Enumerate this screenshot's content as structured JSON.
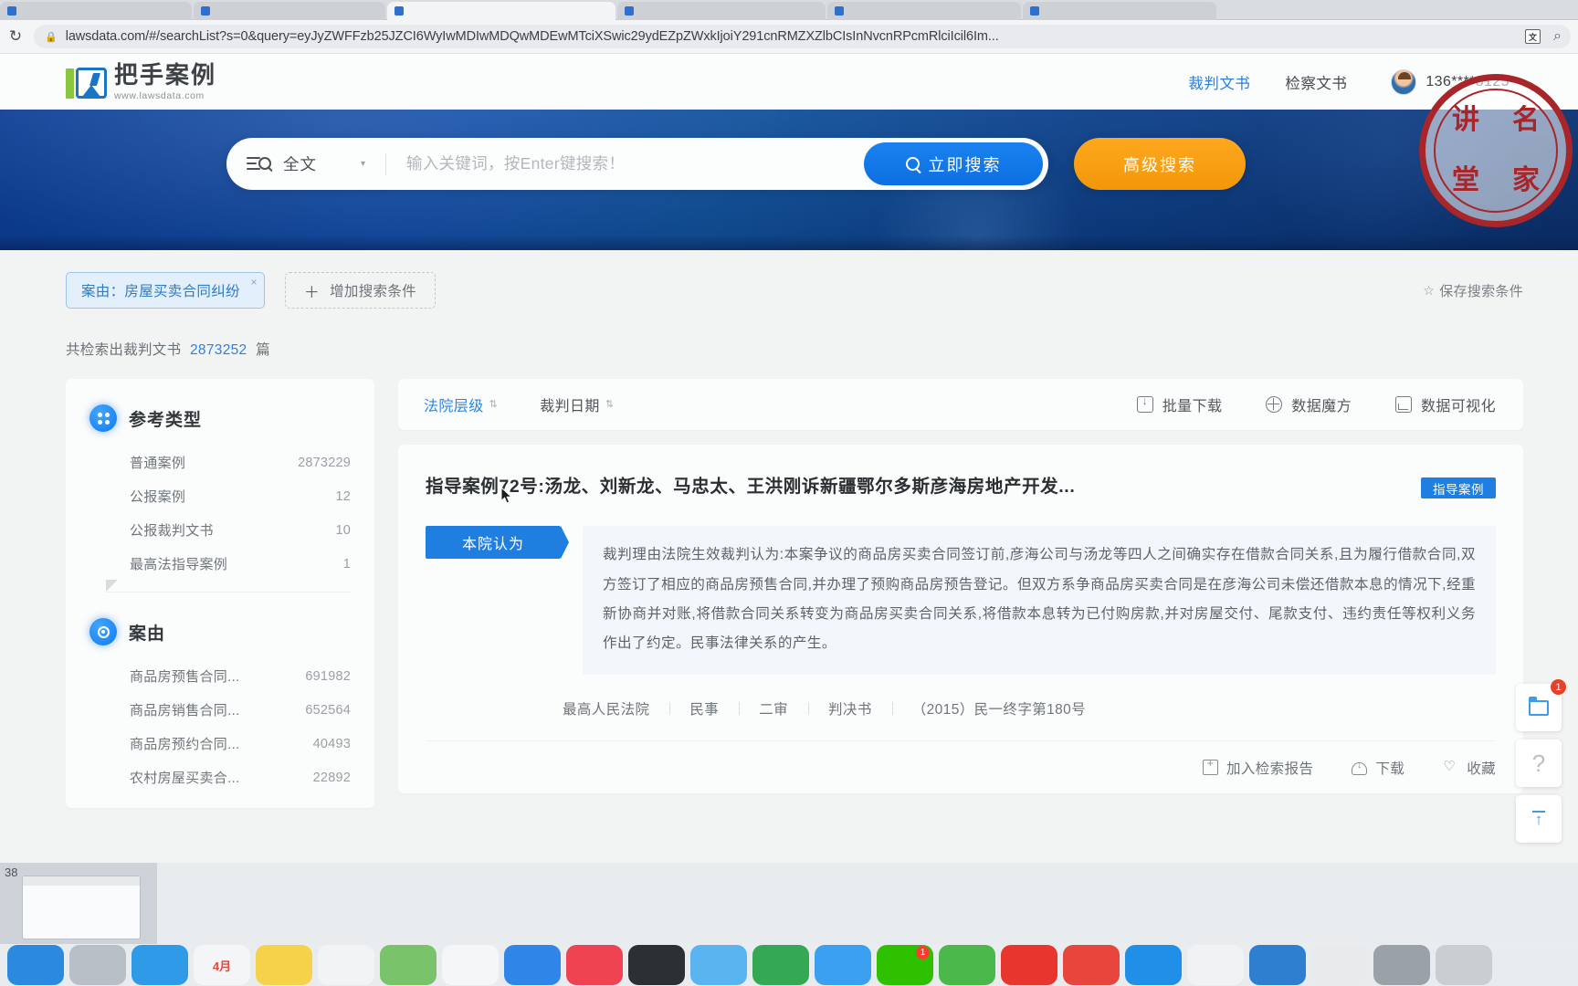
{
  "browser": {
    "url": "lawsdata.com/#/searchList?s=0&query=eyJyZWFFzb25JZCI6WyIwMDIwMDQwMDEwMTciXSwic29ydEZpZWxkIjoiY291cnRMZXZlbCIsInNvcnRPcmRlciIcil6Im...",
    "reload_icon": "↻",
    "lock_icon": "🔒",
    "translate_icon": "文",
    "search_icon": "⌕",
    "tabs": [
      {
        "title": ""
      },
      {
        "title": ""
      },
      {
        "title": ""
      },
      {
        "title": ""
      },
      {
        "title": ""
      },
      {
        "title": ""
      }
    ]
  },
  "site": {
    "brand_name": "把手案例",
    "brand_domain": "www.lawsdata.com",
    "nav": [
      {
        "label": "裁判文书",
        "active": true
      },
      {
        "label": "检察文书",
        "active": false
      }
    ],
    "account": {
      "id": "136****8125",
      "caret": "▾"
    }
  },
  "search": {
    "scope_label": "全文",
    "scope_caret": "▾",
    "placeholder": "输入关键词，按Enter键搜索！",
    "value": "",
    "search_button": "立即搜索",
    "advanced_button": "高级搜索"
  },
  "filters": {
    "chip": {
      "label": "案由：房屋买卖合同纠纷",
      "close": "×"
    },
    "add_condition": "增加搜索条件",
    "add_plus": "＋",
    "save_condition": "保存搜索条件",
    "save_star": "☆"
  },
  "results_summary": {
    "prefix": "共检索出裁判文书",
    "count": "2873252",
    "suffix": "篇"
  },
  "sidebar": {
    "facets": [
      {
        "title": "参考类型",
        "icon": "grid-dots-icon",
        "items": [
          {
            "label": "普通案例",
            "count": "2873229"
          },
          {
            "label": "公报案例",
            "count": "12"
          },
          {
            "label": "公报裁判文书",
            "count": "10"
          },
          {
            "label": "最高法指导案例",
            "count": "1"
          }
        ]
      },
      {
        "title": "案由",
        "icon": "target-icon",
        "items": [
          {
            "label": "商品房预售合同...",
            "count": "691982"
          },
          {
            "label": "商品房销售合同...",
            "count": "652564"
          },
          {
            "label": "商品房预约合同...",
            "count": "40493"
          },
          {
            "label": "农村房屋买卖合...",
            "count": "22892"
          }
        ]
      }
    ]
  },
  "toolbar": {
    "sorts": [
      {
        "label": "法院层级",
        "arrows": "⇅",
        "active": true
      },
      {
        "label": "裁判日期",
        "arrows": "⇅",
        "active": false
      }
    ],
    "actions": [
      {
        "label": "批量下载",
        "icon": "download-icon"
      },
      {
        "label": "数据魔方",
        "icon": "cube-icon"
      },
      {
        "label": "数据可视化",
        "icon": "chart-icon"
      }
    ]
  },
  "result": {
    "title": "指导案例72号:汤龙、刘新龙、马忠太、王洪刚诉新疆鄂尔多斯彦海房地产开发...",
    "badge": "指导案例",
    "excerpt_tag": "本院认为",
    "excerpt": "裁判理由法院生效裁判认为:本案争议的商品房买卖合同签订前,彦海公司与汤龙等四人之间确实存在借款合同关系,且为履行借款合同,双方签订了相应的商品房预售合同,并办理了预购商品房预告登记。但双方系争商品房买卖合同是在彦海公司未偿还借款本息的情况下,经重新协商并对账,将借款合同关系转变为商品房买卖合同关系,将借款本息转为已付购房款,并对房屋交付、尾款支付、违约责任等权利义务作出了约定。民事法律关系的产生。",
    "meta": [
      "最高人民法院",
      "民事",
      "二审",
      "判决书",
      "（2015）民一终字第180号"
    ],
    "footer_actions": [
      {
        "label": "加入检索报告",
        "icon": "add-report-icon"
      },
      {
        "label": "下载",
        "icon": "download-cloud-icon"
      },
      {
        "label": "收藏",
        "icon": "heart-icon"
      }
    ]
  },
  "rail": [
    {
      "icon": "folder-icon",
      "badge": "1"
    },
    {
      "icon": "question-icon",
      "label": "?",
      "badge": ""
    },
    {
      "icon": "back-to-top-icon",
      "badge": ""
    }
  ],
  "seal": {
    "chars": [
      "讲",
      "名",
      "堂",
      "家"
    ]
  },
  "desktop": {
    "window_label": "38",
    "dock": [
      {
        "name": "finder-icon",
        "color": "#2b8ae0",
        "glyph": "",
        "badge": ""
      },
      {
        "name": "launchpad-icon",
        "color": "#b8bfc6",
        "glyph": "",
        "badge": ""
      },
      {
        "name": "safari-icon",
        "color": "#2f9ae8",
        "glyph": "",
        "badge": ""
      },
      {
        "name": "calendar-icon",
        "color": "#f4f5f6",
        "glyph": "4月",
        "badge": ""
      },
      {
        "name": "notes-icon",
        "color": "#f6d24b",
        "glyph": "",
        "badge": ""
      },
      {
        "name": "photos-icon",
        "color": "#f2f3f5",
        "glyph": "",
        "badge": ""
      },
      {
        "name": "maps-icon",
        "color": "#79c46a",
        "glyph": "",
        "badge": ""
      },
      {
        "name": "reminders-icon",
        "color": "#f5f6f7",
        "glyph": "",
        "badge": ""
      },
      {
        "name": "appstore-icon",
        "color": "#2f86e8",
        "glyph": "",
        "badge": ""
      },
      {
        "name": "music-icon",
        "color": "#ef4352",
        "glyph": "",
        "badge": ""
      },
      {
        "name": "terminal-icon",
        "color": "#2c2f33",
        "glyph": "",
        "badge": ""
      },
      {
        "name": "docs-icon",
        "color": "#5ab4f0",
        "glyph": "",
        "badge": ""
      },
      {
        "name": "sheets-icon",
        "color": "#34a853",
        "glyph": "",
        "badge": ""
      },
      {
        "name": "mail-icon",
        "color": "#3aa0ef",
        "glyph": "",
        "badge": ""
      },
      {
        "name": "wechat-icon",
        "color": "#2dc100",
        "glyph": "",
        "badge": "1"
      },
      {
        "name": "qq-icon",
        "color": "#4ab84a",
        "glyph": "",
        "badge": ""
      },
      {
        "name": "netease-icon",
        "color": "#e8352d",
        "glyph": "",
        "badge": ""
      },
      {
        "name": "weibo-icon",
        "color": "#e8453c",
        "glyph": "",
        "badge": ""
      },
      {
        "name": "dingtalk-icon",
        "color": "#1f8fe8",
        "glyph": "",
        "badge": ""
      },
      {
        "name": "chrome-icon",
        "color": "#f1f2f4",
        "glyph": "",
        "badge": ""
      },
      {
        "name": "vscode-icon",
        "color": "#2f7fd0",
        "glyph": "",
        "badge": ""
      },
      {
        "name": "preview-icon",
        "color": "#e9eaec",
        "glyph": "",
        "badge": ""
      },
      {
        "name": "settings-icon",
        "color": "#9aa1a8",
        "glyph": "",
        "badge": ""
      },
      {
        "name": "trash-icon",
        "color": "#c9ced3",
        "glyph": "",
        "badge": ""
      }
    ]
  }
}
